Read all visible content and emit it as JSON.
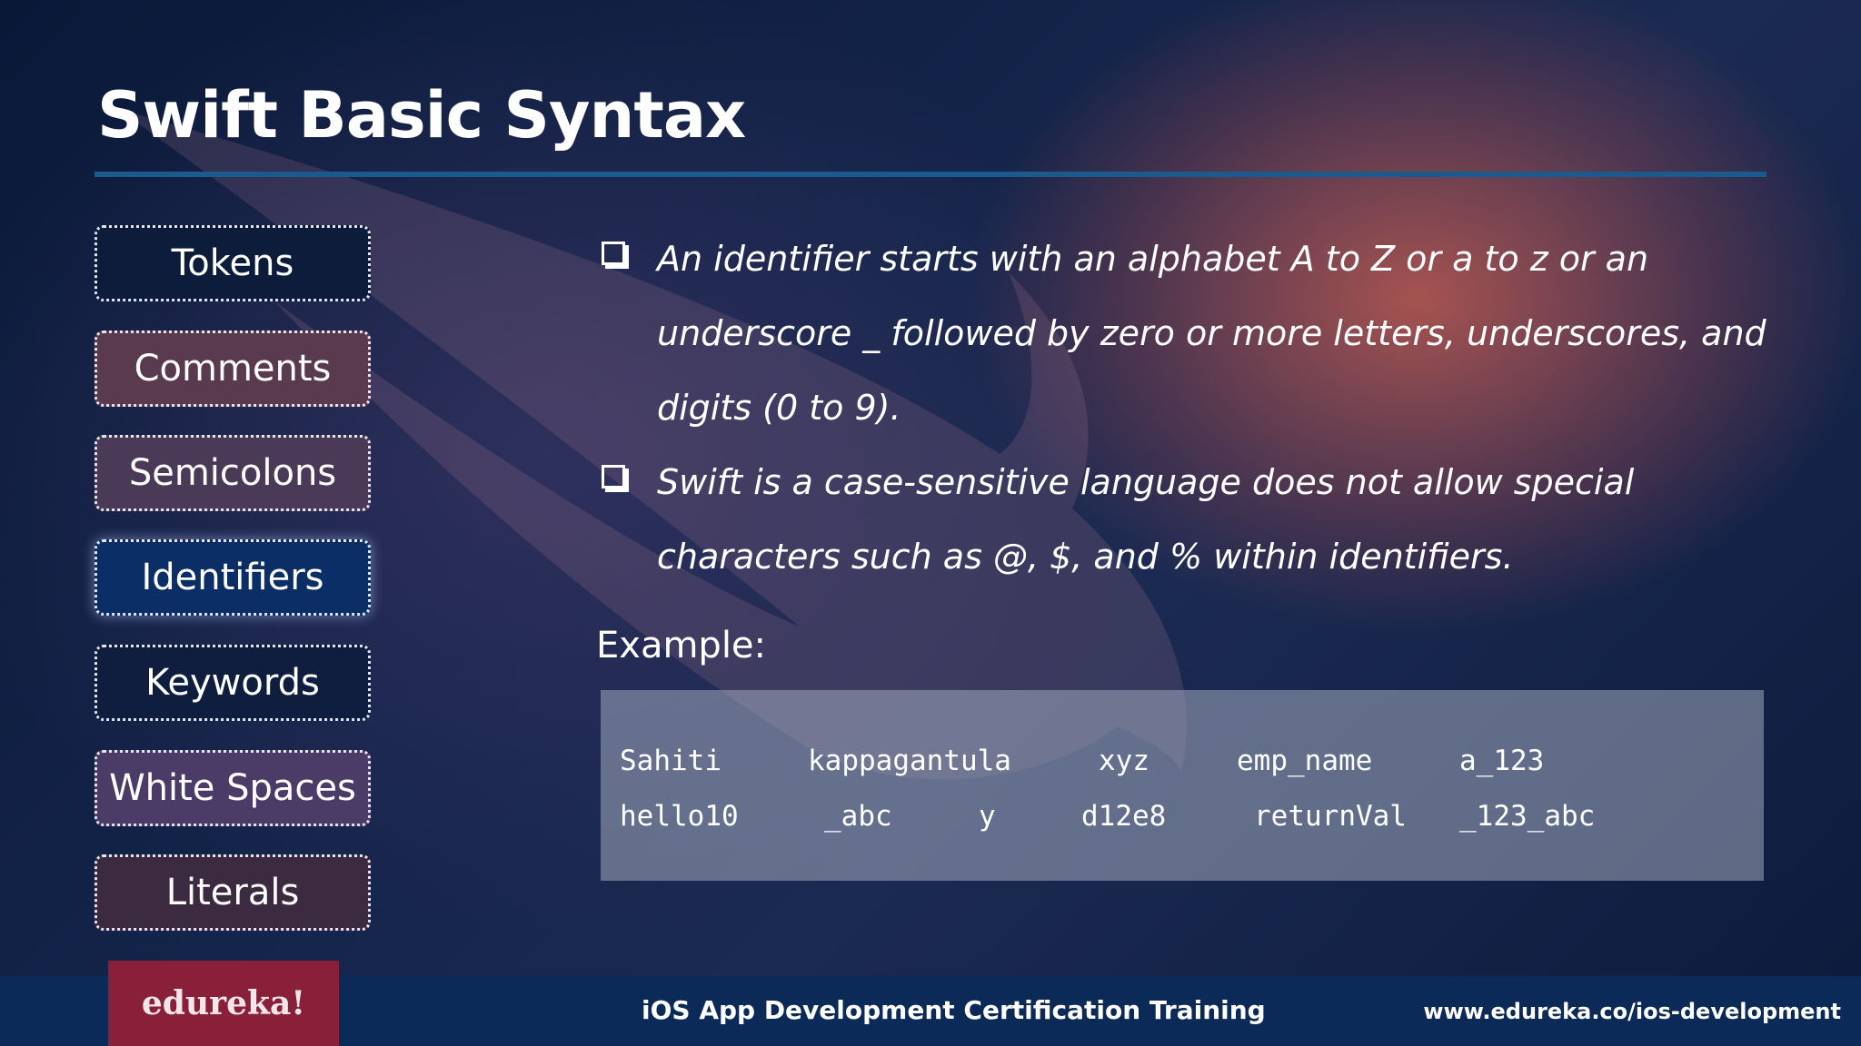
{
  "slide": {
    "title": "Swift Basic Syntax"
  },
  "nav": {
    "items": [
      {
        "label": "Tokens"
      },
      {
        "label": "Comments"
      },
      {
        "label": "Semicolons"
      },
      {
        "label": "Identifiers",
        "active": true
      },
      {
        "label": "Keywords"
      },
      {
        "label": "White Spaces"
      },
      {
        "label": "Literals"
      }
    ]
  },
  "content": {
    "bullets": [
      "An identifier starts with an alphabet A to Z or a to z or an underscore _ followed by zero or more letters, underscores, and digits (0 to 9).",
      "Swift  is a case-sensitive language does not allow special characters such as @, $, and % within identifiers."
    ],
    "example_label": "Example:",
    "examples": [
      [
        "Sahiti",
        "kappagantula",
        "xyz",
        "emp_name",
        "a_123"
      ],
      [
        "hello10",
        "_abc",
        "y",
        "d12e8",
        "returnVal",
        "_123_abc"
      ]
    ]
  },
  "footer": {
    "logo_text": "edureka!",
    "course": "iOS App Development Certification Training",
    "url": "www.edureka.co/ios-development"
  },
  "colors": {
    "accent_rule": "#1a5a8c",
    "active_nav": "#0b2e66",
    "logo_bg": "#8a1f3a",
    "footer_bg": "#0b2a57"
  }
}
